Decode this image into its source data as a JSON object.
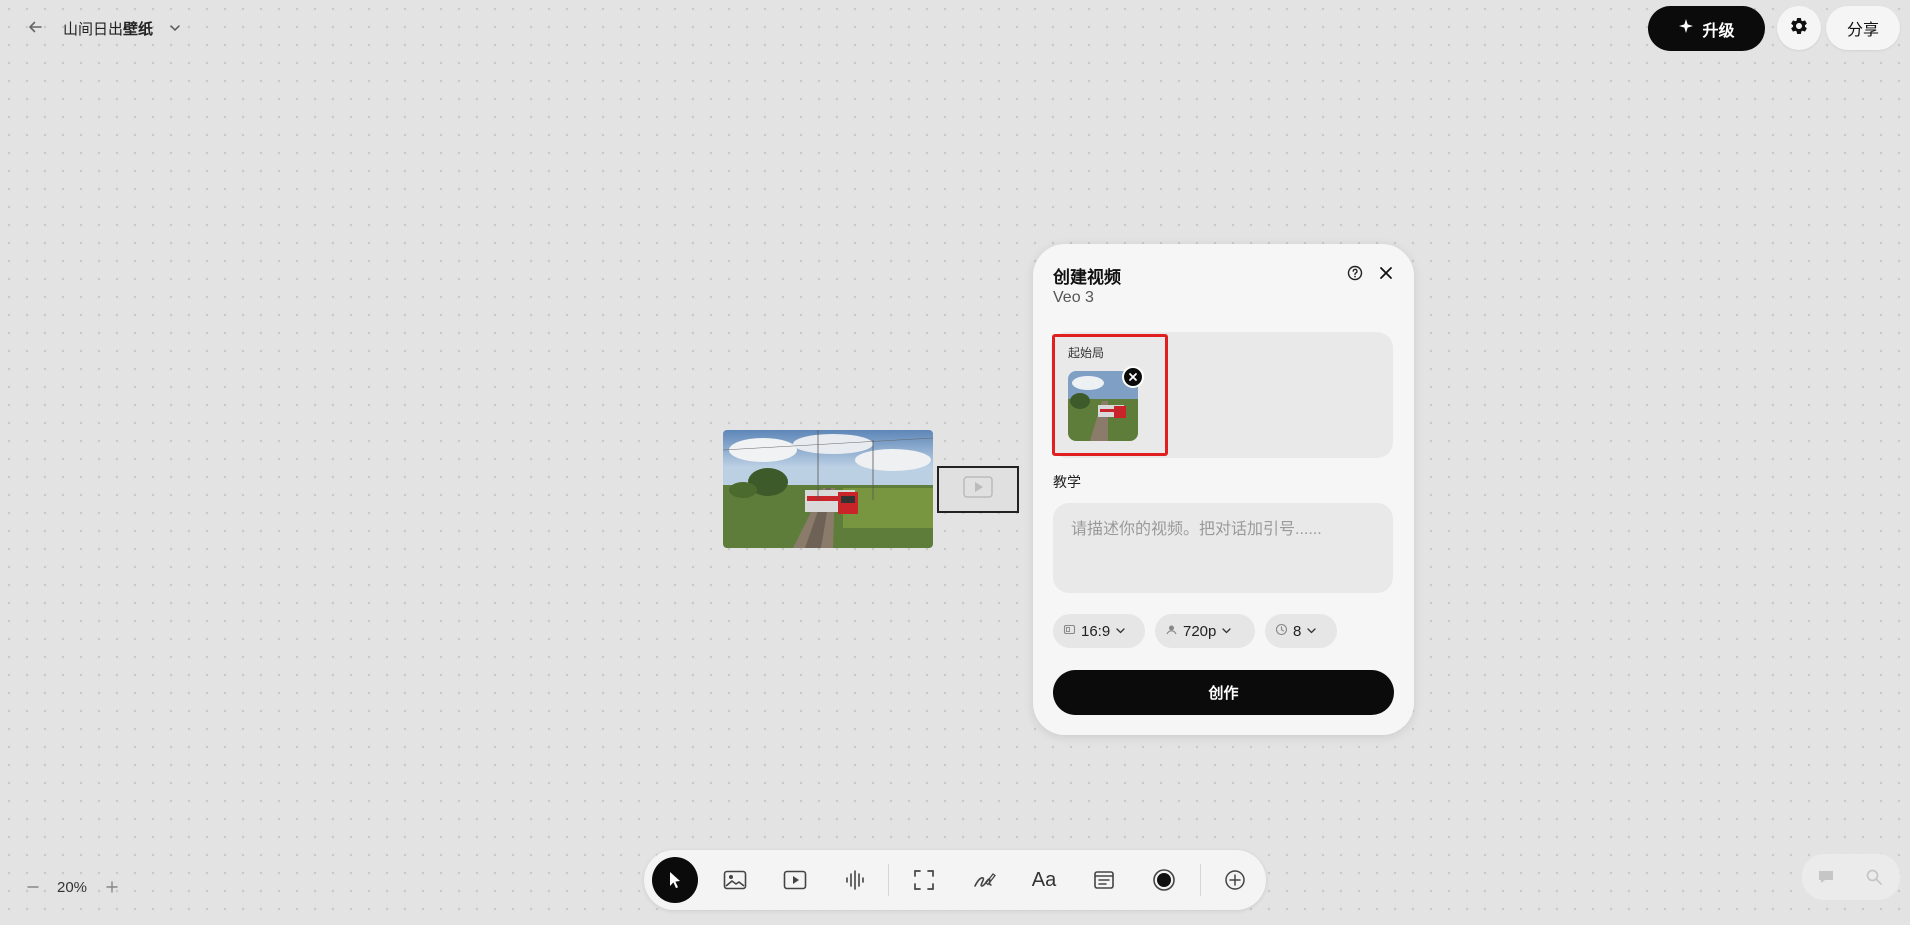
{
  "header": {
    "title_part1": "山间日出",
    "title_part2": "壁纸",
    "upgrade_label": "升级",
    "share_label": "分享"
  },
  "panel": {
    "title": "创建视频",
    "model": "Veo 3",
    "start_frame_label": "起始局",
    "prompt_label": "教学",
    "prompt_placeholder": "请描述你的视频。把对话加引号......",
    "prompt_value": "",
    "aspect_ratio": "16:9",
    "resolution": "720p",
    "duration": "8",
    "create_label": "创作"
  },
  "zoom": {
    "level": "20%"
  },
  "toolbar": {
    "active_tool": "select",
    "tools": [
      "select",
      "image",
      "video",
      "audio",
      "frame",
      "draw",
      "text",
      "note",
      "record",
      "add"
    ]
  },
  "colors": {
    "accent": "#0b0b0b",
    "highlight": "#e02020",
    "canvas": "#e3e3e3",
    "panel": "#f6f6f6"
  }
}
